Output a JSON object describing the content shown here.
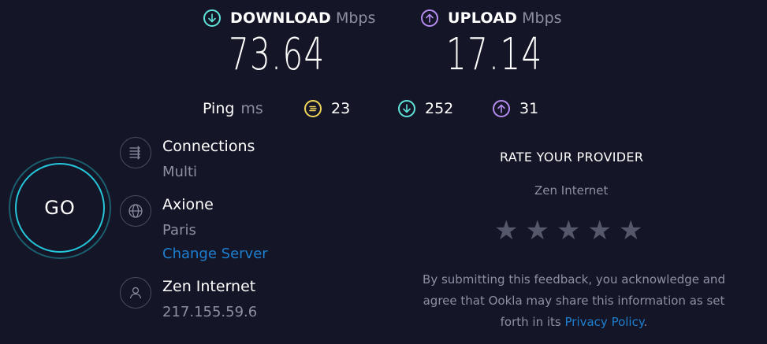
{
  "download": {
    "label": "DOWNLOAD",
    "unit": "Mbps",
    "value": "73.64",
    "color": "#5fe3d8"
  },
  "upload": {
    "label": "UPLOAD",
    "unit": "Mbps",
    "value": "17.14",
    "color": "#b48cf0"
  },
  "ping": {
    "label": "Ping",
    "unit": "ms",
    "idle": "23",
    "download": "252",
    "upload": "31",
    "idle_color": "#f2d65c"
  },
  "go": {
    "label": "GO"
  },
  "connections": {
    "title": "Connections",
    "value": "Multi"
  },
  "server": {
    "title": "Axione",
    "location": "Paris",
    "change_link": "Change Server"
  },
  "provider": {
    "title": "Zen Internet",
    "ip": "217.155.59.6"
  },
  "rating": {
    "title": "RATE YOUR PROVIDER",
    "provider": "Zen Internet",
    "stars": 5,
    "disclaimer_1": "By submitting this feedback, you acknowledge and",
    "disclaimer_2": "agree that Ookla may share this information as set",
    "disclaimer_3_prefix": "forth in its",
    "privacy_link": "Privacy Policy",
    "disclaimer_3_suffix": "."
  }
}
